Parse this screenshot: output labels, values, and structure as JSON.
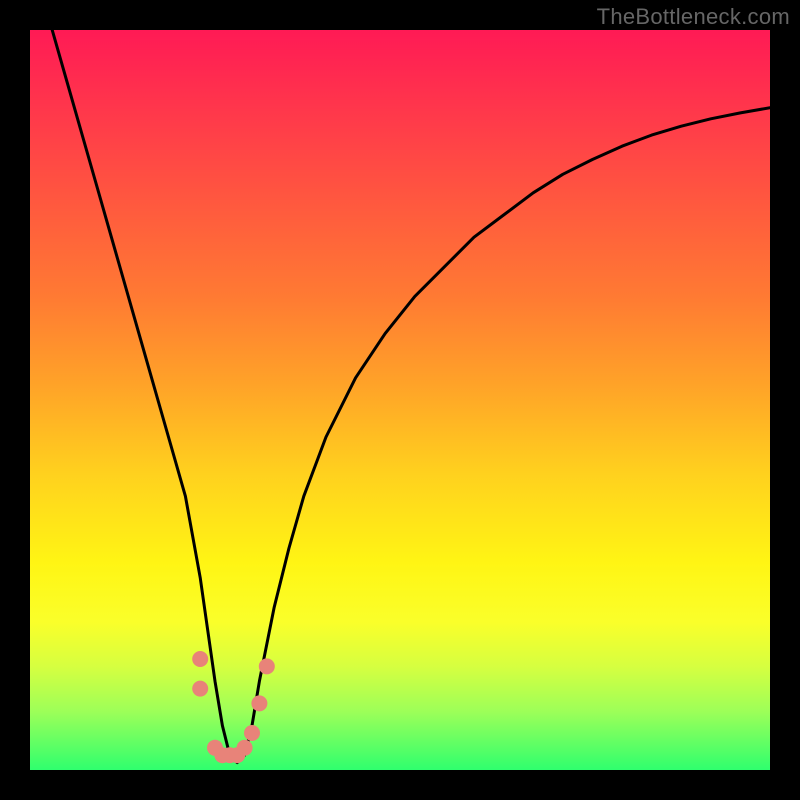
{
  "watermark": "TheBottleneck.com",
  "gradient_colors": {
    "top": "#ff1a55",
    "upper_mid": "#ff7a33",
    "mid": "#ffd11e",
    "lower_mid": "#fff514",
    "bottom": "#2fff6e"
  },
  "chart_data": {
    "type": "line",
    "title": "",
    "xlabel": "",
    "ylabel": "",
    "xlim": [
      0,
      100
    ],
    "ylim": [
      0,
      100
    ],
    "grid": false,
    "legend": false,
    "series": [
      {
        "name": "bottleneck-curve",
        "color": "#000000",
        "x": [
          3,
          5,
          7,
          9,
          11,
          13,
          15,
          17,
          19,
          21,
          23,
          24,
          25,
          26,
          27,
          28,
          29,
          30,
          31,
          33,
          35,
          37,
          40,
          44,
          48,
          52,
          56,
          60,
          64,
          68,
          72,
          76,
          80,
          84,
          88,
          92,
          96,
          100
        ],
        "y": [
          100,
          93,
          86,
          79,
          72,
          65,
          58,
          51,
          44,
          37,
          26,
          19,
          12,
          6,
          2,
          1,
          2,
          6,
          12,
          22,
          30,
          37,
          45,
          53,
          59,
          64,
          68,
          72,
          75,
          78,
          80.5,
          82.5,
          84.3,
          85.8,
          87,
          88,
          88.8,
          89.5
        ]
      }
    ],
    "annotations": [
      {
        "name": "trough-markers",
        "type": "scatter",
        "color": "#e88379",
        "radius": 8,
        "points": [
          {
            "x": 23,
            "y": 15
          },
          {
            "x": 23,
            "y": 11
          },
          {
            "x": 25,
            "y": 3
          },
          {
            "x": 26,
            "y": 2
          },
          {
            "x": 27,
            "y": 2
          },
          {
            "x": 28,
            "y": 2
          },
          {
            "x": 29,
            "y": 3
          },
          {
            "x": 30,
            "y": 5
          },
          {
            "x": 31,
            "y": 9
          },
          {
            "x": 32,
            "y": 14
          }
        ]
      }
    ]
  }
}
